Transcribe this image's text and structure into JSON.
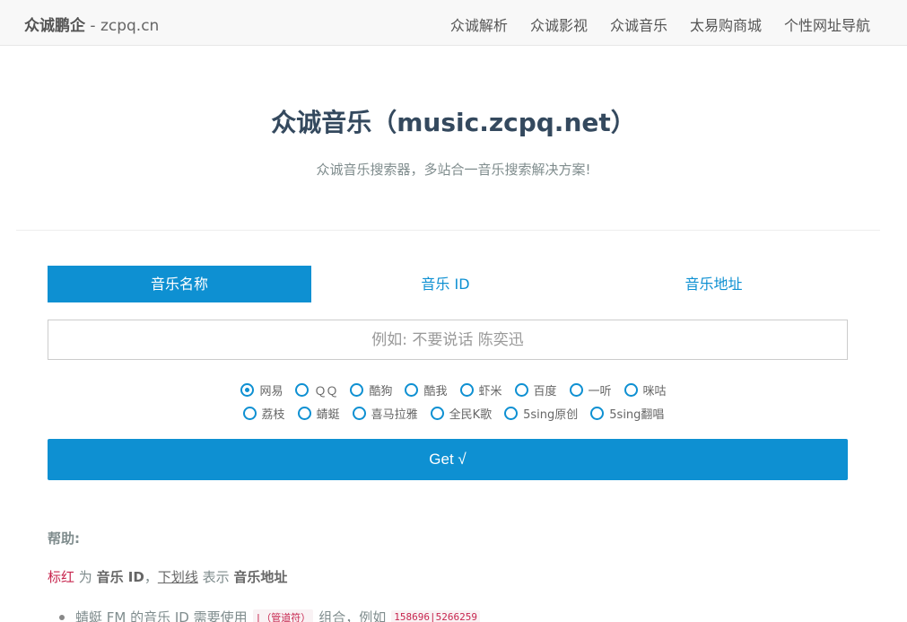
{
  "navbar": {
    "brand": "众诚鹏企",
    "brand_domain": " - zcpq.cn",
    "links": [
      "众诚解析",
      "众诚影视",
      "众诚音乐",
      "太易购商城",
      "个性网址导航"
    ]
  },
  "hero": {
    "title": "众诚音乐（music.zcpq.net）",
    "subtitle": "众诚音乐搜索器，多站合一音乐搜索解决方案!"
  },
  "tabs": [
    {
      "label": "音乐名称",
      "active": true
    },
    {
      "label": "音乐 ID",
      "active": false
    },
    {
      "label": "音乐地址",
      "active": false
    }
  ],
  "search": {
    "placeholder": "例如: 不要说话 陈奕迅",
    "value": ""
  },
  "sources": {
    "row1": [
      "网易",
      "ＱＱ",
      "酷狗",
      "酷我",
      "虾米",
      "百度",
      "一听",
      "咪咕"
    ],
    "row2": [
      "荔枝",
      "蜻蜓",
      "喜马拉雅",
      "全民K歌",
      "5sing原创",
      "5sing翻唱"
    ],
    "selected": "网易"
  },
  "get_button": "Get √",
  "help": {
    "title": "帮助:",
    "line_red": "标红",
    "line_is": " 为 ",
    "line_bold_id": "音乐 ID",
    "line_comma": "，",
    "line_underline": "下划线",
    "line_means": " 表示 ",
    "line_bold_url": "音乐地址",
    "item_prefix": "蜻蜓 FM 的音乐 ID 需要使用",
    "item_code1": "|（管道符）",
    "item_middle": "组合，例如",
    "item_code2": "158696|5266259"
  },
  "colors": {
    "accent": "#0e90d2",
    "navbar_bg": "#f8f8f8",
    "highlight": "#c7254e"
  }
}
